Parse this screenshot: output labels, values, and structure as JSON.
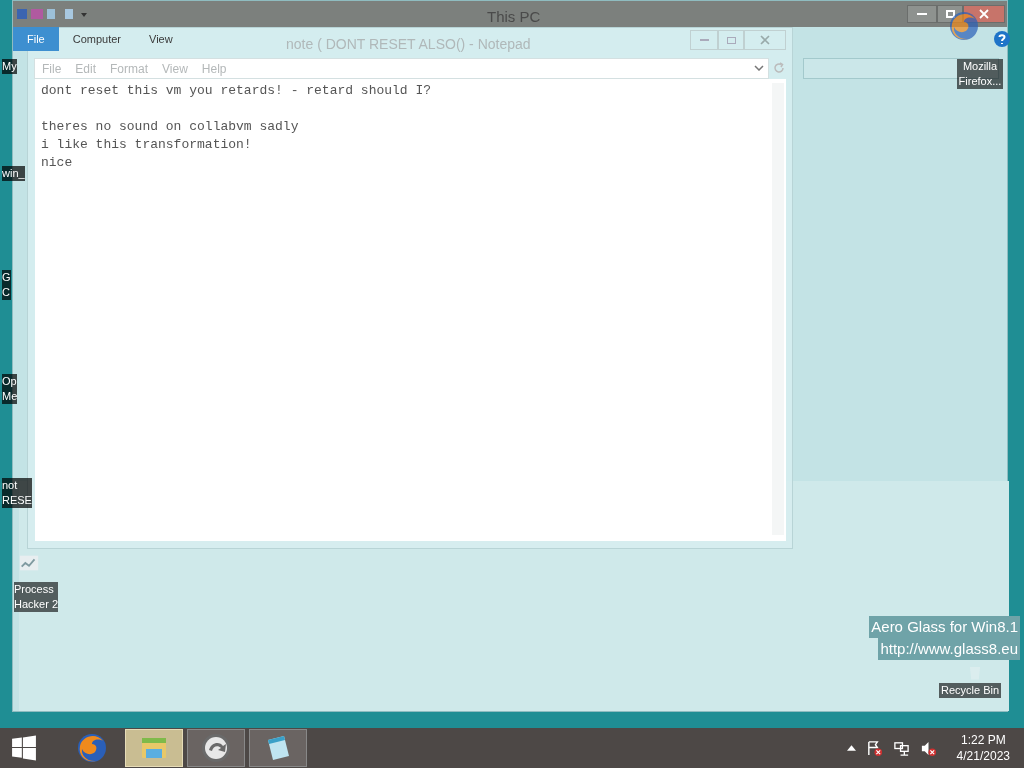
{
  "explorer_window": {
    "title": "This PC",
    "ribbon_tabs": [
      {
        "label": "File",
        "selected": true
      },
      {
        "label": "Computer",
        "selected": false
      },
      {
        "label": "View",
        "selected": false
      }
    ]
  },
  "notepad_window": {
    "title": "note ( DONT RESET ALSO() - Notepad",
    "menu": [
      "File",
      "Edit",
      "Format",
      "View",
      "Help"
    ],
    "paragraphs": [
      [
        "dont reset this vm you retards! - retard should I?"
      ],
      [
        "theres no sound on collabvm sadly",
        "i like this transformation!",
        "nice"
      ]
    ]
  },
  "desktop_icons_left": [
    {
      "lines": [
        "My"
      ]
    },
    {
      "lines": [
        "win_"
      ]
    },
    {
      "lines": [
        "G",
        "C"
      ]
    },
    {
      "lines": [
        "Op",
        "Me"
      ]
    },
    {
      "lines": [
        "not",
        "RESE"
      ]
    },
    {
      "lines": [
        "Process",
        "Hacker 2"
      ]
    }
  ],
  "desktop_icons_right": [
    {
      "kind": "firefox",
      "lines": [
        "Mozilla",
        "Firefox..."
      ]
    },
    {
      "kind": "recycle",
      "lines": [
        "Recycle Bin"
      ]
    }
  ],
  "overlay_text": [
    "Aero Glass for Win8.1",
    "http://www.glass8.eu"
  ],
  "taskbar": {
    "apps": [
      {
        "kind": "firefox",
        "active": false
      },
      {
        "kind": "explorer",
        "active": true
      },
      {
        "kind": "restore",
        "active": false
      },
      {
        "kind": "notepad",
        "active": false
      }
    ],
    "clock": {
      "time": "1:22 PM",
      "date": "4/21/2023"
    }
  }
}
